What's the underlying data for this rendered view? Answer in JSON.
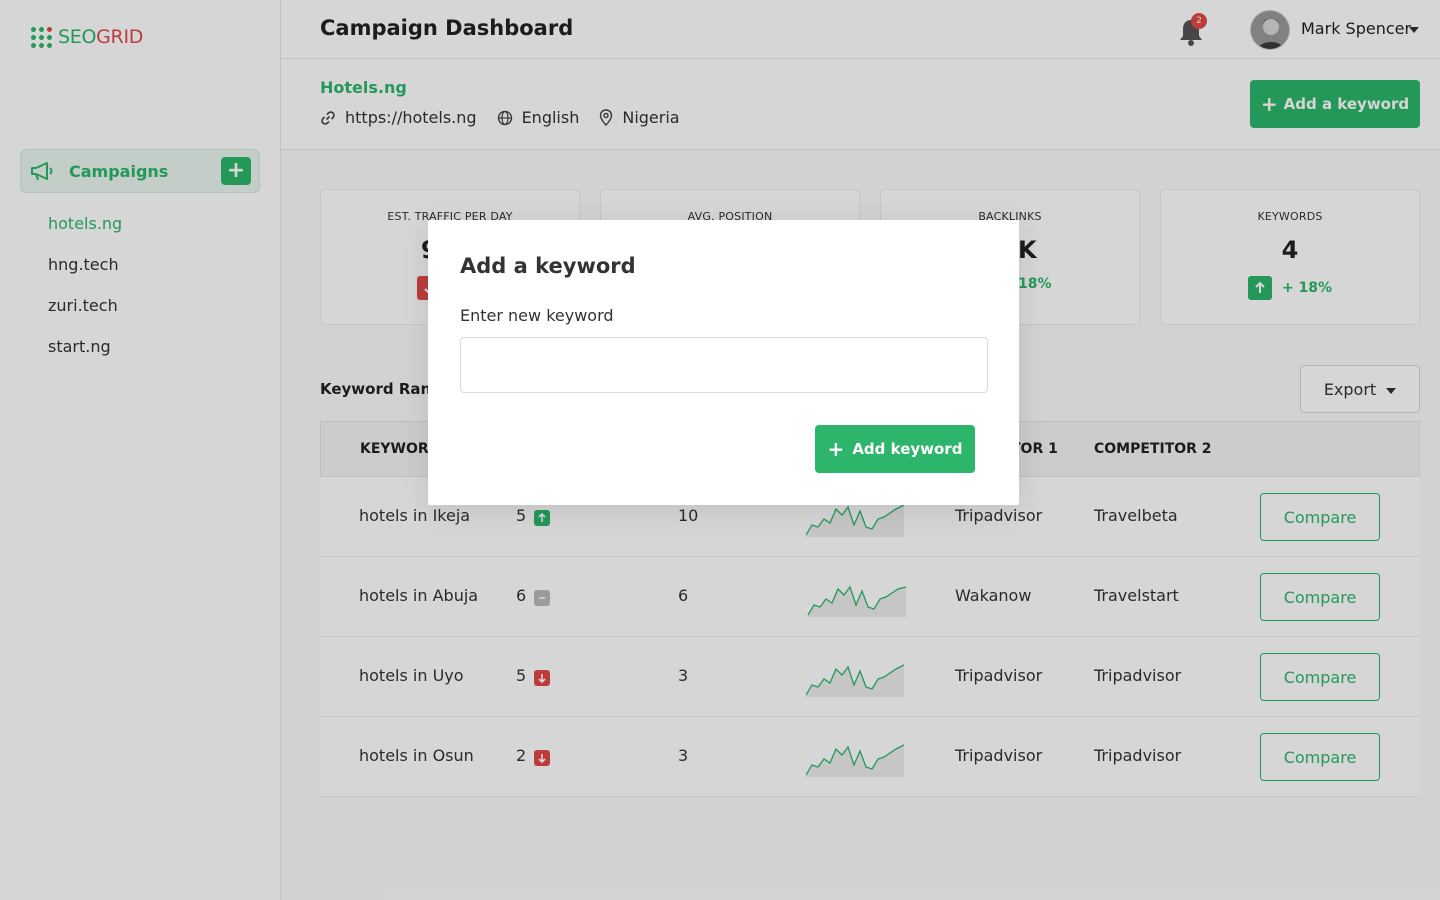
{
  "brand": {
    "seo": "SEO",
    "grid": "GRID",
    "primary_color": "#2cb56b",
    "accent_color": "#e04848"
  },
  "sidebar": {
    "campaigns_label": "Campaigns",
    "items": [
      {
        "label": "hotels.ng",
        "active": true
      },
      {
        "label": "hng.tech",
        "active": false
      },
      {
        "label": "zuri.tech",
        "active": false
      },
      {
        "label": "start.ng",
        "active": false
      }
    ]
  },
  "header": {
    "title": "Campaign Dashboard",
    "notification_count": "2",
    "user_name": "Mark Spencer"
  },
  "campaign": {
    "name": "Hotels.ng",
    "url": "https://hotels.ng",
    "language": "English",
    "location": "Nigeria",
    "add_keyword_label": "Add a keyword"
  },
  "stats": [
    {
      "label": "EST. TRAFFIC PER DAY",
      "value": "9",
      "change": "",
      "trend": "down"
    },
    {
      "label": "AVG. POSITION",
      "value": "",
      "change": "",
      "trend": ""
    },
    {
      "label": "BACKLINKS",
      "value": "K",
      "change": "18%",
      "trend": "up"
    },
    {
      "label": "KEYWORDS",
      "value": "4",
      "change": "+ 18%",
      "trend": "up"
    }
  ],
  "rankings": {
    "title": "Keyword Rank",
    "export_label": "Export",
    "columns": {
      "keyword": "KEYWORD",
      "competitor1": "TOR 1",
      "competitor2": "COMPETITOR 2"
    },
    "rows": [
      {
        "keyword": "hotels in Ikeja",
        "position": "5",
        "trend": "up",
        "volume": "10",
        "competitor1": "Tripadvisor",
        "competitor2": "Travelbeta",
        "action": "Compare"
      },
      {
        "keyword": "hotels in Abuja",
        "position": "6",
        "trend": "flat",
        "volume": "6",
        "competitor1": "Wakanow",
        "competitor2": "Travelstart",
        "action": "Compare"
      },
      {
        "keyword": "hotels in Uyo",
        "position": "5",
        "trend": "down",
        "volume": "3",
        "competitor1": "Tripadvisor",
        "competitor2": "Tripadvisor",
        "action": "Compare"
      },
      {
        "keyword": "hotels in Osun",
        "position": "2",
        "trend": "down",
        "volume": "3",
        "competitor1": "Tripadvisor",
        "competitor2": "Tripadvisor",
        "action": "Compare"
      }
    ]
  },
  "modal": {
    "title": "Add a keyword",
    "label": "Enter new keyword",
    "input_value": "",
    "input_placeholder": "",
    "submit_label": "Add keyword"
  }
}
